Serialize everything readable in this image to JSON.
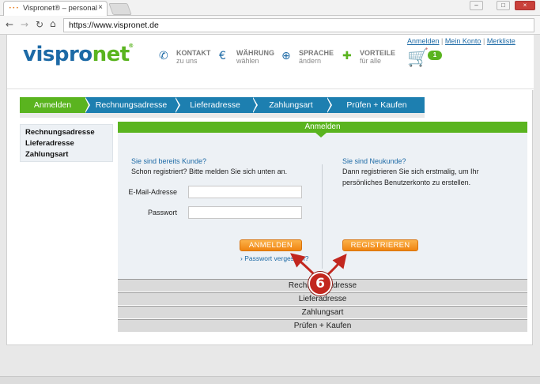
{
  "browser": {
    "tab_title": "Vispronet® – personalisi",
    "tab_close": "×",
    "favicon": "•••",
    "url": "https://www.vispronet.de",
    "nav": {
      "back": "←",
      "forward": "→",
      "reload": "↻",
      "home": "⌂"
    },
    "window_buttons": {
      "minimize": "–",
      "maximize": "□",
      "close": "×"
    }
  },
  "site": {
    "logo_main": "vispro",
    "logo_accent": "net",
    "logo_mark": "®",
    "features": [
      {
        "title": "KONTAKT",
        "subtitle": "zu uns",
        "icon": "phone-icon",
        "glyph": "✆"
      },
      {
        "title": "WÄHRUNG",
        "subtitle": "wählen",
        "icon": "currency-icon",
        "glyph": "€"
      },
      {
        "title": "SPRACHE",
        "subtitle": "ändern",
        "icon": "globe-icon",
        "glyph": "⊕"
      },
      {
        "title": "VORTEILE",
        "subtitle": "für alle",
        "icon": "benefits-icon",
        "glyph": "✚"
      }
    ],
    "top_links": {
      "login": "Anmelden",
      "account": "Mein Konto",
      "wishlist": "Merkliste",
      "separator": "|"
    },
    "cart": {
      "glyph": "🛒",
      "count": "1"
    }
  },
  "steps": [
    "Anmelden",
    "Rechnungsadresse",
    "Lieferadresse",
    "Zahlungsart",
    "Prüfen + Kaufen"
  ],
  "sidebar": [
    "Rechnungsadresse",
    "Lieferadresse",
    "Zahlungsart"
  ],
  "panel": {
    "header": "Anmelden",
    "existing": {
      "title": "Sie sind bereits Kunde?",
      "text": "Schon registriert? Bitte melden Sie sich unten an.",
      "email_label": "E-Mail-Adresse",
      "email_value": "",
      "password_label": "Passwort",
      "password_value": "",
      "login_button": "ANMELDEN",
      "forgot_link": "› Passwort vergessen?"
    },
    "new": {
      "title": "Sie sind Neukunde?",
      "text_line1": "Dann registrieren Sie sich erstmalig, um Ihr",
      "text_line2": "persönliches Benutzerkonto zu erstellen.",
      "register_button": "REGISTRIEREN"
    },
    "accordion": [
      "Rechnungsadresse",
      "Lieferadresse",
      "Zahlungsart",
      "Prüfen + Kaufen"
    ]
  },
  "annotation": {
    "number": "6",
    "color": "#c2271f"
  },
  "colors": {
    "brand_blue": "#1d6aa6",
    "brand_green": "#5ab41f",
    "step_blue": "#1d7fb0",
    "button_orange": "#f08410"
  }
}
